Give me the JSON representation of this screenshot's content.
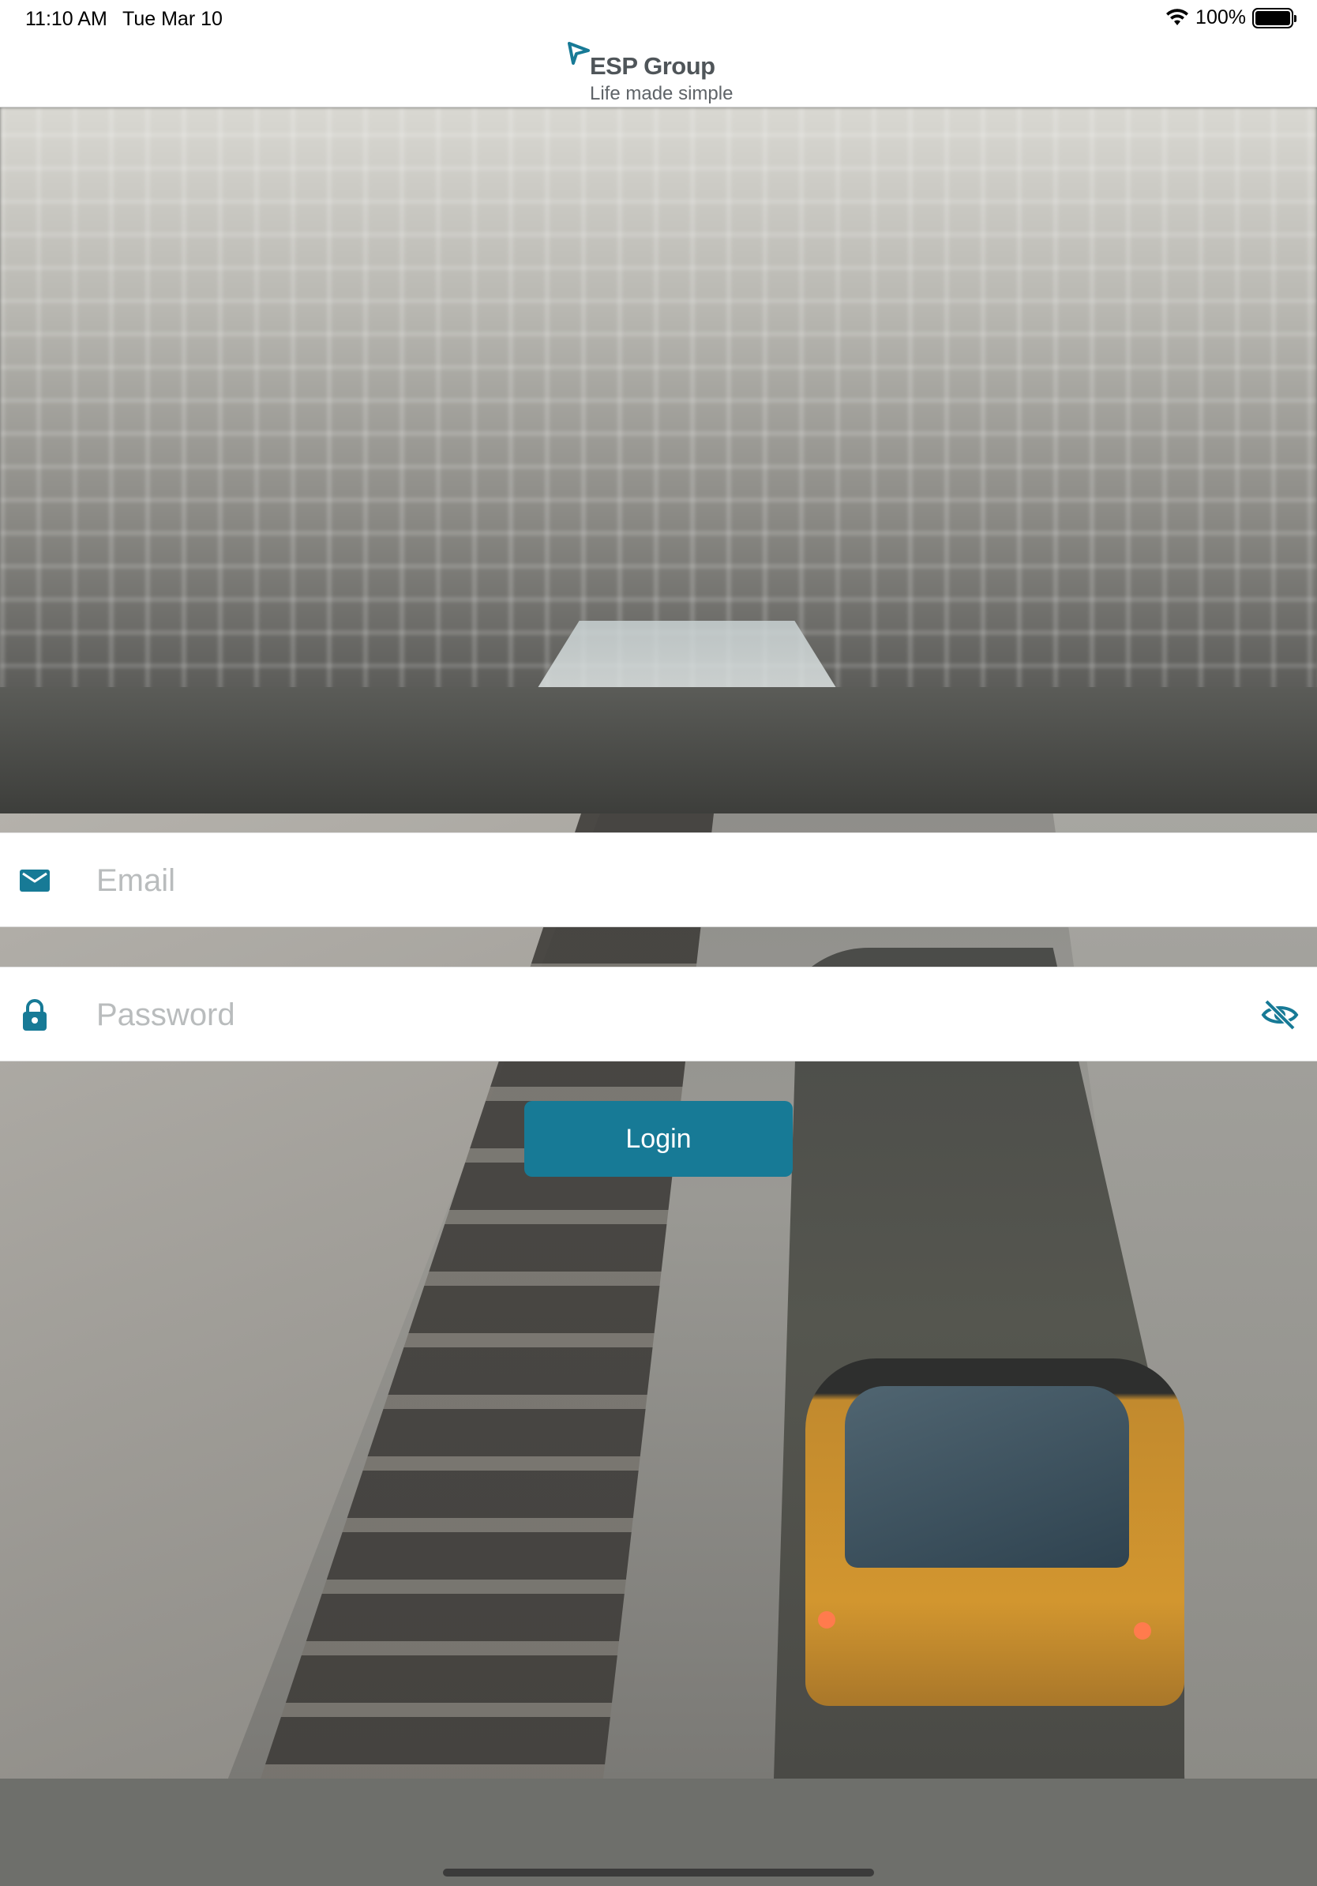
{
  "status_bar": {
    "time": "11:10 AM",
    "date": "Tue Mar 10",
    "battery": "100%",
    "wifi_icon": "wifi-icon",
    "battery_icon": "battery-icon"
  },
  "header": {
    "brand": "ESP Group",
    "tagline": "Life made simple"
  },
  "login_form": {
    "email": {
      "placeholder": "Email",
      "value": "",
      "icon": "mail-icon"
    },
    "password": {
      "placeholder": "Password",
      "value": "",
      "icon": "lock-icon",
      "toggle_icon": "eye-slash-icon"
    },
    "submit_label": "Login"
  },
  "colors": {
    "accent": "#177a96",
    "field_background": "#ffffff",
    "placeholder": "#b9bcbd",
    "brand_text": "#4f5559"
  }
}
